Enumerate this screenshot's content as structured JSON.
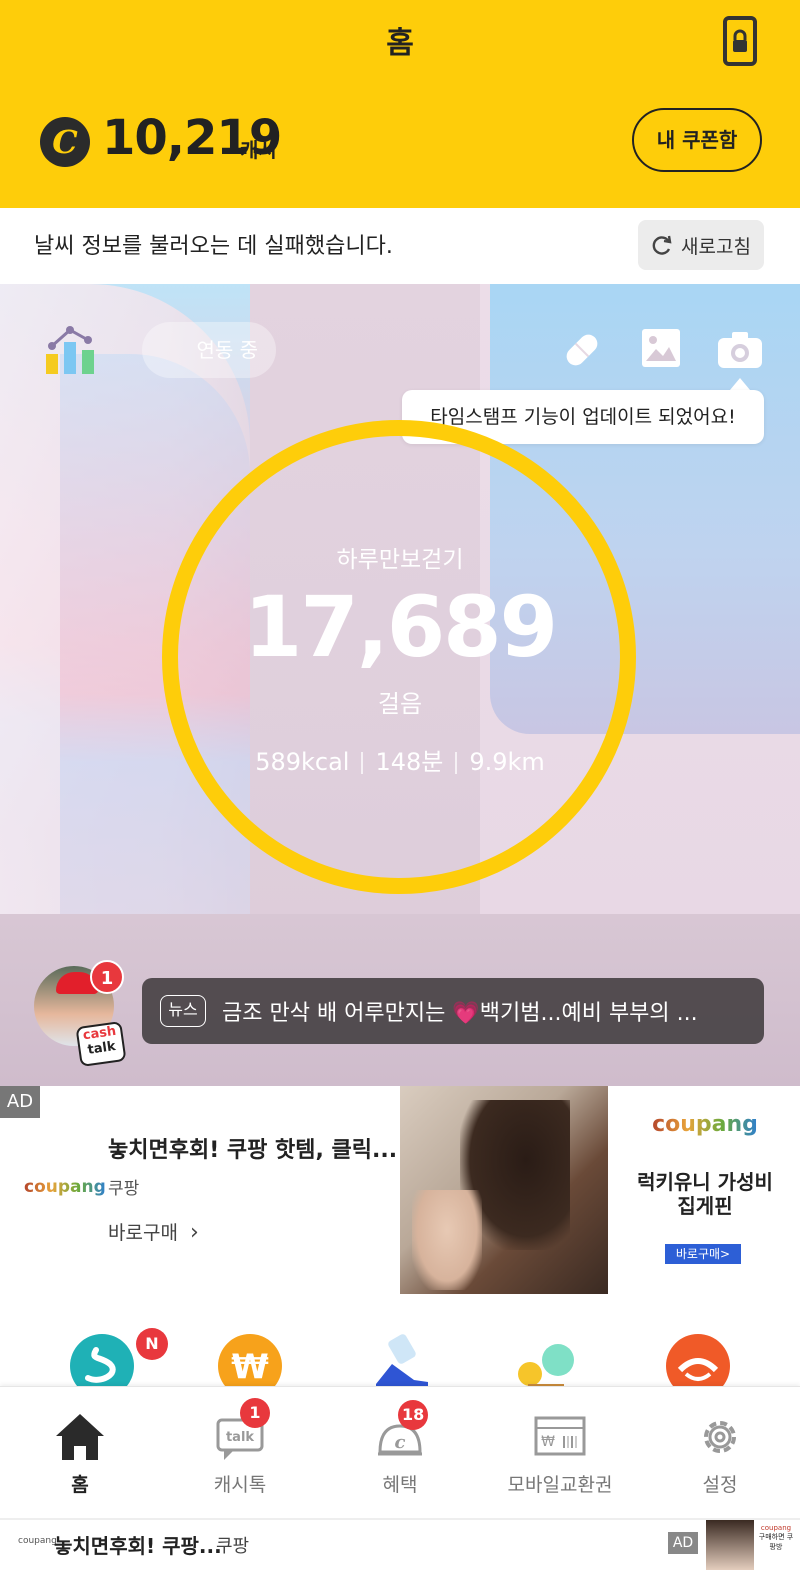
{
  "header": {
    "title": "홈",
    "cash_amount": "10,219",
    "cash_unit": "캐시",
    "cash_icon_letter": "C",
    "coupon_button": "내 쿠폰함"
  },
  "weather": {
    "message": "날씨 정보를 불러오는 데 실패했습니다.",
    "refresh_label": "새로고침"
  },
  "hero": {
    "sync_label": "연동 중",
    "tooltip": "타임스탬프 기능이 업데이트 되었어요!",
    "walk_title": "하루만보걷기",
    "steps": "17,689",
    "steps_unit": "걸음",
    "kcal": "589kcal",
    "minutes": "148분",
    "distance": "9.9km",
    "ring_color": "#FECD0A"
  },
  "news": {
    "tag": "뉴스",
    "headline": "금조 만삭 배 어루만지는 💗백기범...예비 부부의 ...",
    "badge_count": "1",
    "sticker_text_1": "cash",
    "sticker_text_2": "talk"
  },
  "ad": {
    "label": "AD",
    "brand_left": "coupang",
    "title": "놓치면후회! 쿠팡 핫템, 클릭...",
    "sub": "쿠팡",
    "buy_label": "바로구매",
    "right_brand": "coupang",
    "right_title_1": "럭키유니 가성비",
    "right_title_2": "집게핀",
    "right_button": "바로구매>"
  },
  "quick_icons": {
    "first_badge": "N"
  },
  "nav": {
    "items": [
      {
        "label": "홈",
        "icon": "home-icon"
      },
      {
        "label": "캐시톡",
        "icon": "talk-icon",
        "badge": "1"
      },
      {
        "label": "혜택",
        "icon": "benefit-icon",
        "badge": "18"
      },
      {
        "label": "모바일교환권",
        "icon": "coupon-ticket-icon"
      },
      {
        "label": "설정",
        "icon": "gear-icon"
      }
    ]
  },
  "banner": {
    "brand": "coupang",
    "title": "놓치면후회! 쿠팡...",
    "sub": "쿠팡",
    "ad_label": "AD",
    "thumb_brand": "coupang",
    "thumb_text": "구매하면 쿠팡방"
  },
  "colors": {
    "brand_yellow": "#FECD0A",
    "badge_red": "#E8383D"
  }
}
